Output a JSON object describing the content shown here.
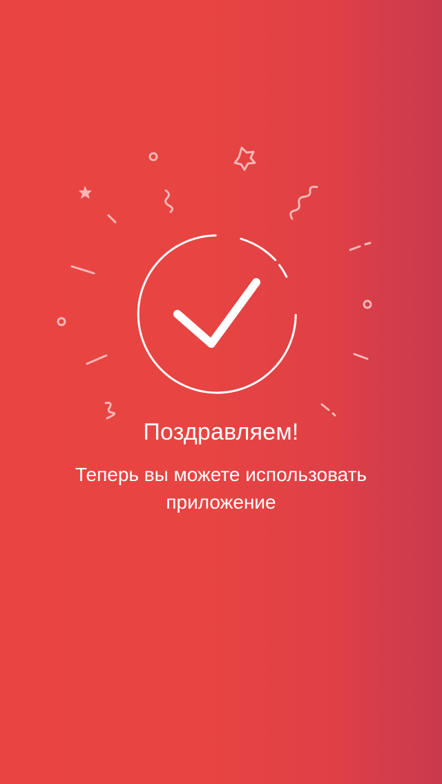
{
  "colors": {
    "background_left": "#E94441",
    "background_right": "#C93A4E",
    "foreground": "#FFFFFF",
    "confetti": "#F6B7B6"
  },
  "icons": {
    "success": "checkmark-circle-icon",
    "decoration": "confetti-icon"
  },
  "success": {
    "title": "Поздравляем!",
    "message": "Теперь вы можете использовать приложение"
  }
}
